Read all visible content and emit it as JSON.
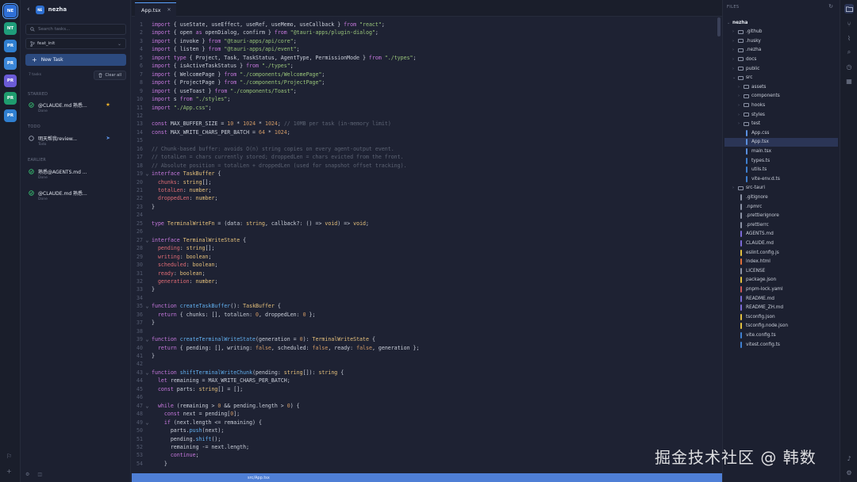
{
  "rail": {
    "items": [
      {
        "label": "NE",
        "color": "#2e6fd6",
        "active": true
      },
      {
        "label": "NT",
        "color": "#1f9d7a",
        "dot": true
      },
      {
        "label": "PR",
        "color": "#2f7fd0"
      },
      {
        "label": "PR",
        "color": "#3a86d8"
      },
      {
        "label": "PR",
        "color": "#6b5bd6"
      },
      {
        "label": "PR",
        "color": "#1f9d6e"
      },
      {
        "label": "PR",
        "color": "#2f7fd0"
      }
    ]
  },
  "tasks": {
    "project_badge": "NE",
    "project_name": "nezha",
    "search_placeholder": "Search tasks...",
    "branch": "feat_init",
    "new_task": "New Task",
    "count": "7 tasks",
    "clear_all": "Clear all",
    "sections": {
      "starred": "STARRED",
      "todo": "TODO",
      "earlier": "EARLIER"
    },
    "items": [
      {
        "title": "@CLAUDE.md 熟悉...",
        "status": "Done"
      },
      {
        "title": "明天帮我review...",
        "status": "Todo"
      },
      {
        "title": "熟悉@AGENTS.md ...",
        "status": "Done"
      },
      {
        "title": "@CLAUDE.md 熟悉...",
        "status": "Done"
      }
    ]
  },
  "editor": {
    "tab": "App.tsx",
    "status_path": "src/App.tsx",
    "lines": [
      {
        "n": "1",
        "h": "<span class='k'>import</span> { useState, useEffect, useRef, useMemo, useCallback } <span class='k'>from</span> <span class='s'>\"react\"</span>;"
      },
      {
        "n": "2",
        "h": "<span class='k'>import</span> { open <span class='k'>as</span> openDialog, confirm } <span class='k'>from</span> <span class='s'>\"@tauri-apps/plugin-dialog\"</span>;"
      },
      {
        "n": "3",
        "h": "<span class='k'>import</span> { invoke } <span class='k'>from</span> <span class='s'>\"@tauri-apps/api/core\"</span>;"
      },
      {
        "n": "4",
        "h": "<span class='k'>import</span> { listen } <span class='k'>from</span> <span class='s'>\"@tauri-apps/api/event\"</span>;"
      },
      {
        "n": "5",
        "h": "<span class='k'>import type</span> { Project, Task, TaskStatus, AgentType, PermissionMode } <span class='k'>from</span> <span class='s'>\"./types\"</span>;"
      },
      {
        "n": "6",
        "h": "<span class='k'>import</span> { isActiveTaskStatus } <span class='k'>from</span> <span class='s'>\"./types\"</span>;"
      },
      {
        "n": "7",
        "h": "<span class='k'>import</span> { WelcomePage } <span class='k'>from</span> <span class='s'>\"./components/WelcomePage\"</span>;"
      },
      {
        "n": "8",
        "h": "<span class='k'>import</span> { ProjectPage } <span class='k'>from</span> <span class='s'>\"./components/ProjectPage\"</span>;"
      },
      {
        "n": "9",
        "h": "<span class='k'>import</span> { useToast } <span class='k'>from</span> <span class='s'>\"./components/Toast\"</span>;"
      },
      {
        "n": "10",
        "h": "<span class='k'>import</span> s <span class='k'>from</span> <span class='s'>\"./styles\"</span>;"
      },
      {
        "n": "11",
        "h": "<span class='k'>import</span> <span class='s'>\"./App.css\"</span>;"
      },
      {
        "n": "12",
        "h": ""
      },
      {
        "n": "13",
        "h": "<span class='k'>const</span> MAX_BUFFER_SIZE = <span class='n'>10</span> * <span class='n'>1024</span> * <span class='n'>1024</span>; <span class='c'>// 10MB per task (in-memory limit)</span>"
      },
      {
        "n": "14",
        "h": "<span class='k'>const</span> MAX_WRITE_CHARS_PER_BATCH = <span class='n'>64</span> * <span class='n'>1024</span>;"
      },
      {
        "n": "15",
        "h": ""
      },
      {
        "n": "16",
        "h": "<span class='c'>// Chunk-based buffer: avoids O(n) string copies on every agent-output event.</span>"
      },
      {
        "n": "17",
        "h": "<span class='c'>// totalLen = chars currently stored; droppedLen = chars evicted from the front.</span>"
      },
      {
        "n": "18",
        "h": "<span class='c'>// Absolute position = totalLen + droppedLen (used for snapshot offset tracking).</span>"
      },
      {
        "n": "19",
        "fold": "⌄",
        "h": "<span class='k'>interface</span> <span class='t'>TaskBuffer</span> {"
      },
      {
        "n": "20",
        "h": "  <span class='p'>chunks</span>: <span class='t'>string</span>[];"
      },
      {
        "n": "21",
        "h": "  <span class='p'>totalLen</span>: <span class='t'>number</span>;"
      },
      {
        "n": "22",
        "h": "  <span class='p'>droppedLen</span>: <span class='t'>number</span>;"
      },
      {
        "n": "23",
        "h": "}"
      },
      {
        "n": "24",
        "h": ""
      },
      {
        "n": "25",
        "h": "<span class='k'>type</span> <span class='t'>TerminalWriteFn</span> = (data: <span class='t'>string</span>, callback?: () => <span class='t'>void</span>) => <span class='t'>void</span>;"
      },
      {
        "n": "26",
        "h": ""
      },
      {
        "n": "27",
        "fold": "⌄",
        "h": "<span class='k'>interface</span> <span class='t'>TerminalWriteState</span> {"
      },
      {
        "n": "28",
        "h": "  <span class='p'>pending</span>: <span class='t'>string</span>[];"
      },
      {
        "n": "29",
        "h": "  <span class='p'>writing</span>: <span class='t'>boolean</span>;"
      },
      {
        "n": "30",
        "h": "  <span class='p'>scheduled</span>: <span class='t'>boolean</span>;"
      },
      {
        "n": "31",
        "h": "  <span class='p'>ready</span>: <span class='t'>boolean</span>;"
      },
      {
        "n": "32",
        "h": "  <span class='p'>generation</span>: <span class='t'>number</span>;"
      },
      {
        "n": "33",
        "h": "}"
      },
      {
        "n": "34",
        "h": ""
      },
      {
        "n": "35",
        "fold": "⌄",
        "h": "<span class='k'>function</span> <span class='f'>createTaskBuffer</span>(): <span class='t'>TaskBuffer</span> {"
      },
      {
        "n": "36",
        "h": "  <span class='k'>return</span> { chunks: [], totalLen: <span class='n'>0</span>, droppedLen: <span class='n'>0</span> };"
      },
      {
        "n": "37",
        "h": "}"
      },
      {
        "n": "38",
        "h": ""
      },
      {
        "n": "39",
        "fold": "⌄",
        "h": "<span class='k'>function</span> <span class='f'>createTerminalWriteState</span>(generation = <span class='n'>0</span>): <span class='t'>TerminalWriteState</span> {"
      },
      {
        "n": "40",
        "h": "  <span class='k'>return</span> { pending: [], writing: <span class='n'>false</span>, scheduled: <span class='n'>false</span>, ready: <span class='n'>false</span>, generation };"
      },
      {
        "n": "41",
        "h": "}"
      },
      {
        "n": "42",
        "h": ""
      },
      {
        "n": "43",
        "fold": "⌄",
        "h": "<span class='k'>function</span> <span class='f'>shiftTerminalWriteChunk</span>(pending: <span class='t'>string</span>[]): <span class='t'>string</span> {"
      },
      {
        "n": "44",
        "h": "  <span class='k'>let</span> remaining = MAX_WRITE_CHARS_PER_BATCH;"
      },
      {
        "n": "45",
        "h": "  <span class='k'>const</span> parts: <span class='t'>string</span>[] = [];"
      },
      {
        "n": "46",
        "h": ""
      },
      {
        "n": "47",
        "fold": "⌄",
        "h": "  <span class='k'>while</span> (remaining > <span class='n'>0</span> && pending.length > <span class='n'>0</span>) {"
      },
      {
        "n": "48",
        "h": "    <span class='k'>const</span> next = pending[<span class='n'>0</span>];"
      },
      {
        "n": "49",
        "fold": "⌄",
        "h": "    <span class='k'>if</span> (next.length <= remaining) {"
      },
      {
        "n": "50",
        "h": "      parts.<span class='f'>push</span>(next);"
      },
      {
        "n": "51",
        "h": "      pending.<span class='f'>shift</span>();"
      },
      {
        "n": "52",
        "h": "      remaining -= next.length;"
      },
      {
        "n": "53",
        "h": "      <span class='k'>continue</span>;"
      },
      {
        "n": "54",
        "h": "    }"
      }
    ]
  },
  "files": {
    "header": "FILES",
    "tree": [
      {
        "name": "nezha",
        "depth": 0,
        "type": "root",
        "open": true
      },
      {
        "name": ".github",
        "depth": 1,
        "type": "folder"
      },
      {
        "name": ".husky",
        "depth": 1,
        "type": "folder"
      },
      {
        "name": ".nezha",
        "depth": 1,
        "type": "folder"
      },
      {
        "name": "docs",
        "depth": 1,
        "type": "folder"
      },
      {
        "name": "public",
        "depth": 1,
        "type": "folder"
      },
      {
        "name": "src",
        "depth": 1,
        "type": "folder",
        "open": true
      },
      {
        "name": "assets",
        "depth": 2,
        "type": "folder"
      },
      {
        "name": "components",
        "depth": 2,
        "type": "folder"
      },
      {
        "name": "hooks",
        "depth": 2,
        "type": "folder"
      },
      {
        "name": "styles",
        "depth": 2,
        "type": "folder"
      },
      {
        "name": "test",
        "depth": 2,
        "type": "folder"
      },
      {
        "name": "App.css",
        "depth": 2,
        "type": "file",
        "color": "#5a8fe0"
      },
      {
        "name": "App.tsx",
        "depth": 2,
        "type": "file",
        "color": "#5a8fe0",
        "selected": true
      },
      {
        "name": "main.tsx",
        "depth": 2,
        "type": "file",
        "color": "#5a8fe0"
      },
      {
        "name": "types.ts",
        "depth": 2,
        "type": "file",
        "color": "#3f7fd0"
      },
      {
        "name": "utils.ts",
        "depth": 2,
        "type": "file",
        "color": "#3f7fd0"
      },
      {
        "name": "vite-env.d.ts",
        "depth": 2,
        "type": "file",
        "color": "#3f7fd0"
      },
      {
        "name": "src-tauri",
        "depth": 1,
        "type": "folder"
      },
      {
        "name": ".gitignore",
        "depth": 1,
        "type": "file",
        "color": "#8b92a5"
      },
      {
        "name": ".npmrc",
        "depth": 1,
        "type": "file",
        "color": "#8b92a5"
      },
      {
        "name": ".prettierignore",
        "depth": 1,
        "type": "file",
        "color": "#8b92a5"
      },
      {
        "name": ".prettierrc",
        "depth": 1,
        "type": "file",
        "color": "#8b92a5"
      },
      {
        "name": "AGENTS.md",
        "depth": 1,
        "type": "file",
        "color": "#7b6ad6"
      },
      {
        "name": "CLAUDE.md",
        "depth": 1,
        "type": "file",
        "color": "#7b6ad6"
      },
      {
        "name": "eslint.config.js",
        "depth": 1,
        "type": "file",
        "color": "#e2c040"
      },
      {
        "name": "index.html",
        "depth": 1,
        "type": "file",
        "color": "#e0703a"
      },
      {
        "name": "LICENSE",
        "depth": 1,
        "type": "file",
        "color": "#8b92a5"
      },
      {
        "name": "package.json",
        "depth": 1,
        "type": "file",
        "color": "#e2c040"
      },
      {
        "name": "pnpm-lock.yaml",
        "depth": 1,
        "type": "file",
        "color": "#d05a5a"
      },
      {
        "name": "README.md",
        "depth": 1,
        "type": "file",
        "color": "#7b6ad6"
      },
      {
        "name": "README_ZH.md",
        "depth": 1,
        "type": "file",
        "color": "#7b6ad6"
      },
      {
        "name": "tsconfig.json",
        "depth": 1,
        "type": "file",
        "color": "#e2c040"
      },
      {
        "name": "tsconfig.node.json",
        "depth": 1,
        "type": "file",
        "color": "#e2c040"
      },
      {
        "name": "vite.config.ts",
        "depth": 1,
        "type": "file",
        "color": "#3f7fd0"
      },
      {
        "name": "vitest.config.ts",
        "depth": 1,
        "type": "file",
        "color": "#3f7fd0"
      }
    ]
  },
  "watermark": "掘金技术社区 @ 韩数",
  "colors": {
    "accent": "#5aa2ff",
    "done": "#38c172",
    "star": "#f0b429",
    "todo": "#5a8fe0"
  }
}
